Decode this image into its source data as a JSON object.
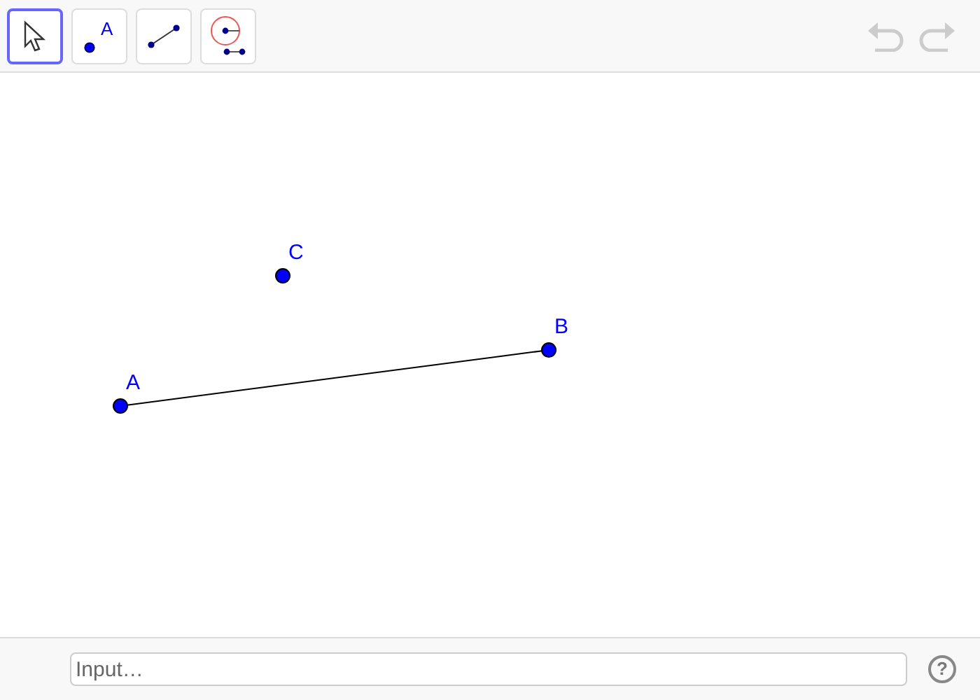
{
  "toolbar": {
    "tools": [
      {
        "kind": "move",
        "selected": true
      },
      {
        "kind": "point",
        "selected": false,
        "glyph": "A"
      },
      {
        "kind": "segment",
        "selected": false
      },
      {
        "kind": "circle",
        "selected": false
      }
    ],
    "undo": {
      "disabled": true
    },
    "redo": {
      "disabled": true
    }
  },
  "canvas": {
    "points": [
      {
        "label": "A"
      },
      {
        "label": "B"
      },
      {
        "label": "C"
      }
    ]
  },
  "input_bar": {
    "placeholder": "Input…",
    "help": "?"
  }
}
